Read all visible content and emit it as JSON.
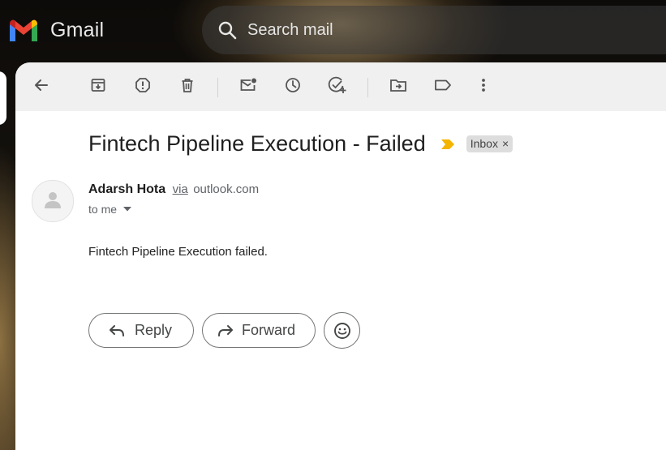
{
  "app": {
    "name": "Gmail",
    "logo_colors": [
      "#4285F4",
      "#EA4335",
      "#FBBC04",
      "#34A853",
      "#C5221F"
    ]
  },
  "search": {
    "placeholder": "Search mail",
    "icon": "search-icon"
  },
  "toolbar": {
    "buttons": [
      {
        "icon": "back-arrow-icon",
        "name": "back-button"
      },
      {
        "icon": "archive-icon",
        "name": "archive-button"
      },
      {
        "icon": "report-spam-icon",
        "name": "report-spam-button"
      },
      {
        "icon": "delete-icon",
        "name": "delete-button"
      },
      {
        "icon": "mark-unread-icon",
        "name": "mark-unread-button"
      },
      {
        "icon": "snooze-icon",
        "name": "snooze-button"
      },
      {
        "icon": "add-task-icon",
        "name": "add-to-tasks-button"
      },
      {
        "icon": "move-to-icon",
        "name": "move-to-button"
      },
      {
        "icon": "label-icon",
        "name": "labels-button"
      },
      {
        "icon": "more-vert-icon",
        "name": "more-button"
      }
    ]
  },
  "message": {
    "subject": "Fintech Pipeline Execution - Failed",
    "importance_color": "#F4B400",
    "label": "Inbox",
    "label_remove": "×",
    "sender_name": "Adarsh Hota",
    "via_text": "via",
    "via_domain": "outlook.com",
    "recipient": "to me",
    "body": "Fintech Pipeline Execution failed."
  },
  "actions": {
    "reply_label": "Reply",
    "forward_label": "Forward",
    "emoji_icon": "emoji-reaction-icon"
  }
}
